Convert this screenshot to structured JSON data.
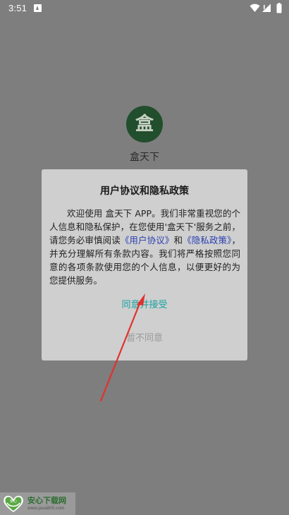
{
  "status_bar": {
    "time": "3:51",
    "icons": [
      "notification-icon",
      "wifi-icon",
      "signal-icon",
      "battery-icon"
    ]
  },
  "app": {
    "logo_glyph": "盒",
    "name": "盒天下"
  },
  "dialog": {
    "title": "用户协议和隐私政策",
    "body_prefix": "欢迎使用 盒天下 APP。我们非常重视您的个人信息和隐私保护，在您使用'盒天下'服务之前，请您务必审慎阅读",
    "user_agreement_link": "《用户协议》",
    "conjunction": "和",
    "privacy_policy_link": "《隐私政策》",
    "body_suffix": "，并充分理解所有条款内容。我们将严格按照您同意的各项条款使用您的个人信息，以便更好的为您提供服务。",
    "accept_label": "同意并接受",
    "decline_label": "暂不同意"
  },
  "watermark": {
    "title": "安心下载网",
    "url": "www.java800.com",
    "badge_text": "安心"
  },
  "colors": {
    "scrim": "#7e7e7e",
    "dialog_bg": "#cfcfcf",
    "link": "#2a3fb0",
    "accept": "#1aa1a1",
    "decline": "#9a9a9a",
    "arrow": "#e0322e",
    "logo_bg": "#214e2d"
  }
}
